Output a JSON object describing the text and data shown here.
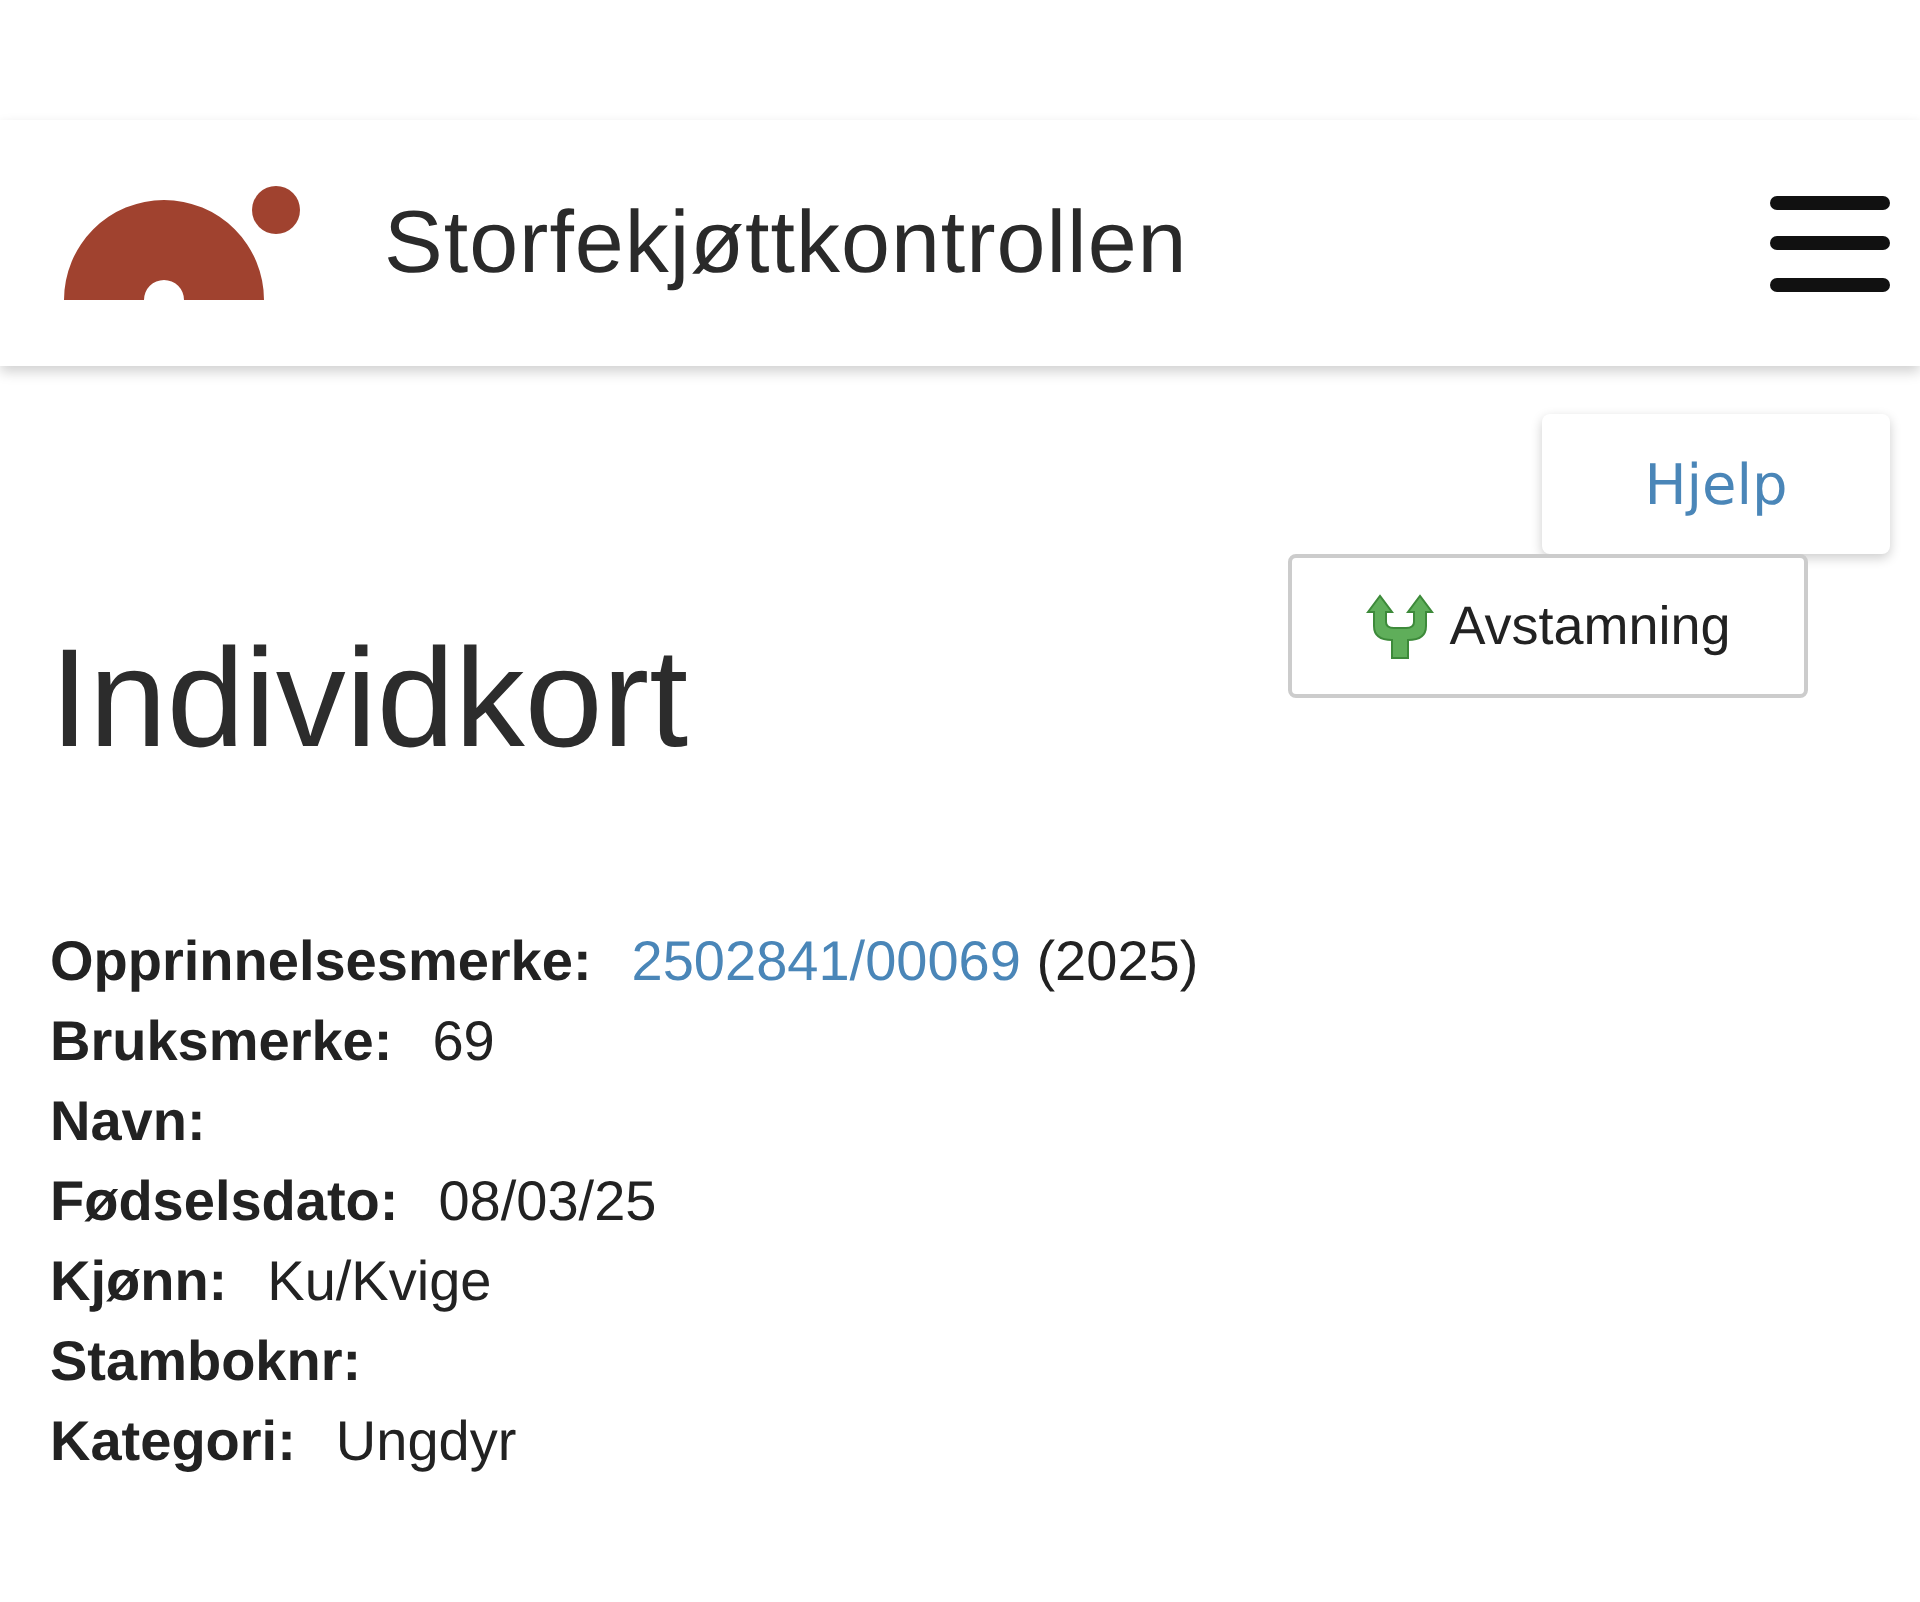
{
  "header": {
    "title": "Storfekjøttkontrollen"
  },
  "help_button": {
    "label": "Hjelp"
  },
  "pedigree_button": {
    "label": "Avstamning"
  },
  "heading": "Individkort",
  "fields": [
    {
      "label": "Opprinnelsesmerke:",
      "link": "2502841/00069",
      "value": "(2025)"
    },
    {
      "label": "Bruksmerke:",
      "value": "69"
    },
    {
      "label": "Navn:"
    },
    {
      "label": "Fødselsdato:",
      "value": "08/03/25"
    },
    {
      "label": "Kjønn:",
      "value": "Ku/Kvige"
    },
    {
      "label": "Stamboknr:"
    },
    {
      "label": "Kategori:",
      "value": "Ungdyr"
    }
  ]
}
